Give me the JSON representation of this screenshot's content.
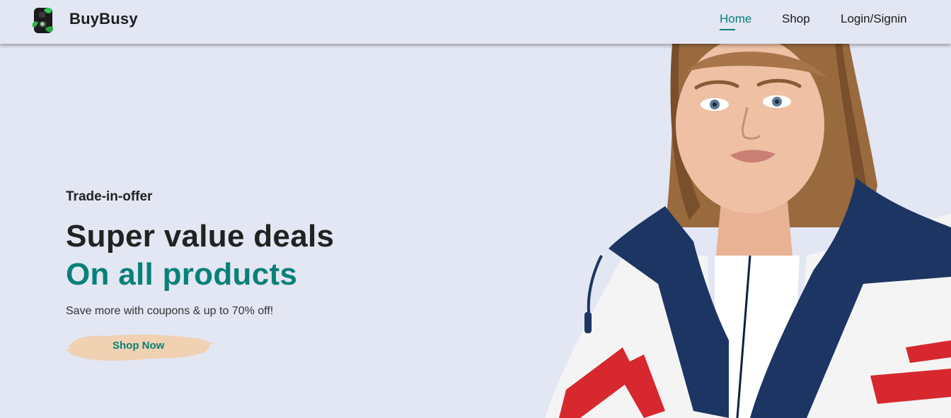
{
  "header": {
    "brand": "BuyBusy",
    "logo_icon": "brand-logo-icon",
    "nav": [
      {
        "label": "Home",
        "active": true
      },
      {
        "label": "Shop",
        "active": false
      },
      {
        "label": "Login/Signin",
        "active": false
      }
    ]
  },
  "hero": {
    "eyebrow": "Trade-in-offer",
    "headline_line1": "Super value deals",
    "headline_line2": "On all products",
    "subtext": "Save more with coupons & up to 70% off!",
    "cta_label": "Shop Now",
    "image": "model-in-windbreaker-jacket"
  },
  "colors": {
    "background": "#e3e6f3",
    "accent": "#088178",
    "text_dark": "#222222",
    "button_brush": "#f0d1b2"
  }
}
